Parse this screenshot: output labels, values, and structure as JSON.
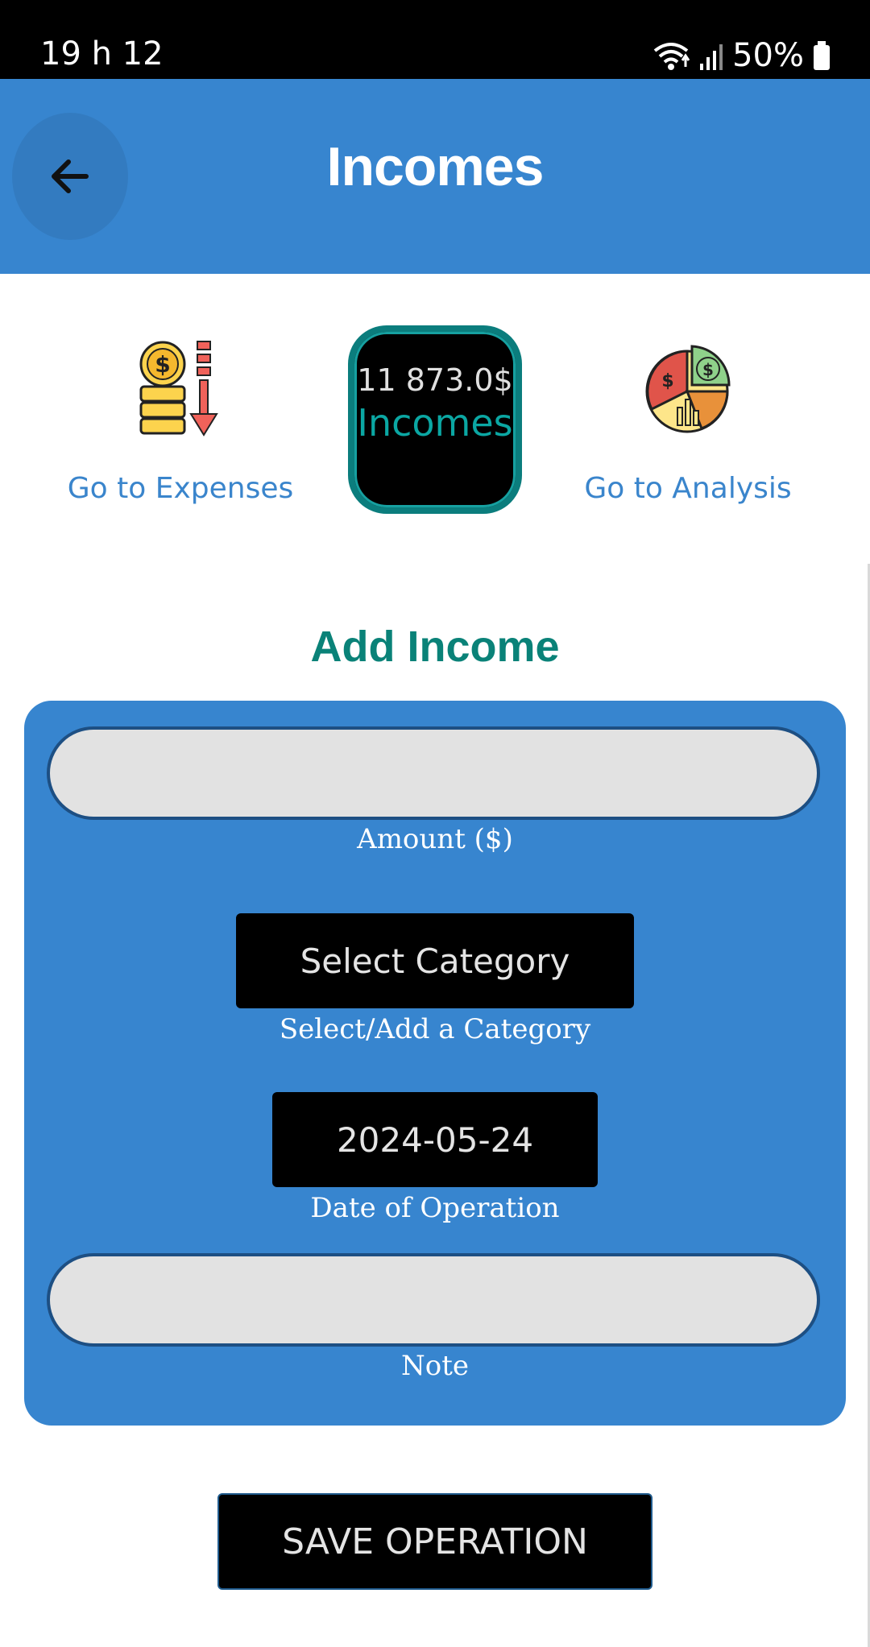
{
  "status_bar": {
    "time": "19 h 12",
    "battery": "50%",
    "icons": [
      "wifi-icon",
      "signal-icon",
      "battery-icon"
    ]
  },
  "app_bar": {
    "title": "Incomes",
    "back_icon": "arrow-left-icon",
    "color": "#3785cf"
  },
  "nav": {
    "expenses_label": "Go to Expenses",
    "expenses_icon": "coins-down-arrow-icon",
    "analysis_label": "Go to Analysis",
    "analysis_icon": "pie-chart-dollar-icon"
  },
  "balance": {
    "amount": "11 873.0$",
    "label": "Incomes"
  },
  "form": {
    "title": "Add Income",
    "amount_value": "",
    "amount_label": "Amount ($)",
    "category_button": "Select Category",
    "category_label": "Select/Add a Category",
    "date_button": "2024-05-24",
    "date_label": "Date of Operation",
    "note_value": "",
    "note_label": "Note"
  },
  "actions": {
    "save_label": "SAVE OPERATION"
  }
}
